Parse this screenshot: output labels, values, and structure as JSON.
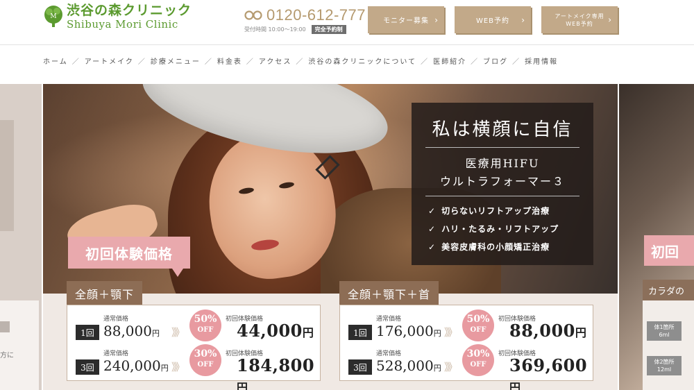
{
  "header": {
    "logo_jp": "渋谷の森クリニック",
    "logo_en": "Shibuya Mori Clinic",
    "phone": "0120-612-777",
    "hours": "受付時間 10:00〜19:00",
    "reservation_badge": "完全予約制",
    "buttons": {
      "monitor": "モニター募集",
      "web_reserve": "WEB予約",
      "art_make_reserve": "アートメイク専用\nWEB予約"
    }
  },
  "nav": {
    "items": [
      "ホーム",
      "アートメイク",
      "診療メニュー",
      "料金表",
      "アクセス",
      "渋谷の森クリニックについて",
      "医師紹介",
      "ブログ",
      "採用情報"
    ],
    "separator": "／"
  },
  "slide": {
    "headline": "私は横顔に自信",
    "subtitle_1": "医療用HIFU",
    "subtitle_2": "ウルトラフォーマー３",
    "features": [
      "切らないリフトアップ治療",
      "ハリ・たるみ・リフトアップ",
      "美容皮膚科の小顔矯正治療"
    ],
    "check": "✓",
    "trial_tag": "初回体験価格",
    "regular_label": "通常価格",
    "trial_label": "初回体験価格",
    "off_text": "OFF",
    "yen": "円",
    "arrows": "》》",
    "panels": [
      {
        "title": "全顔＋顎下",
        "rows": [
          {
            "count": "1回",
            "regular": "88,000",
            "discount": "50%",
            "trial": "44,000"
          },
          {
            "count": "3回",
            "regular": "240,000",
            "discount": "30%",
            "trial": "184,800"
          }
        ]
      },
      {
        "title": "全顔＋顎下＋首",
        "rows": [
          {
            "count": "1回",
            "regular": "176,000",
            "discount": "50%",
            "trial": "88,000"
          },
          {
            "count": "3回",
            "regular": "528,000",
            "discount": "30%",
            "trial": "369,600"
          }
        ]
      }
    ]
  },
  "side_right": {
    "trial_tag": "初回",
    "bar_label": "カラダの",
    "chip_1": "体1箇所\n6ml",
    "chip_2": "体2箇所\n12ml"
  },
  "side_left": {
    "text": "方に"
  },
  "colors": {
    "brand_green": "#5b9a2f",
    "gold": "#c2a989",
    "pink": "#e9a9ad",
    "brown": "#8d6d55"
  }
}
